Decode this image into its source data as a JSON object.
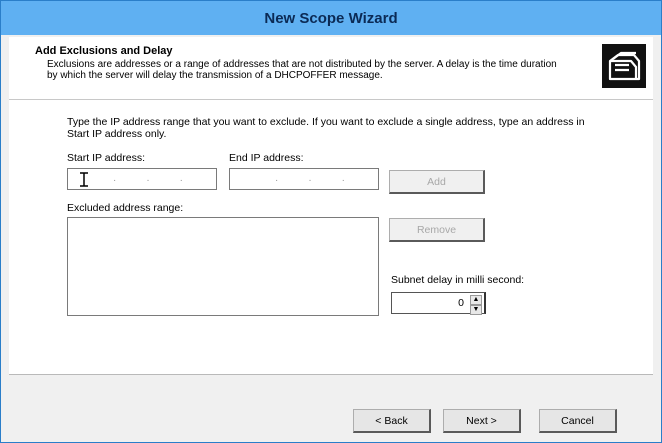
{
  "window": {
    "title": "New Scope Wizard"
  },
  "header": {
    "title": "Add Exclusions and Delay",
    "description": "Exclusions are addresses or a range of addresses that are not distributed by the server. A delay is the time duration by which the server will delay the transmission of a DHCPOFFER message.",
    "icon": "wizard-folders-icon"
  },
  "content": {
    "intro": "Type the IP address range that you want to exclude. If you want to exclude a single address, type an address in Start IP address only.",
    "start_ip_label": "Start IP address:",
    "start_ip_value": "",
    "end_ip_label": "End IP address:",
    "end_ip_value": "",
    "add_button": "Add",
    "excluded_label": "Excluded address range:",
    "excluded_items": [],
    "remove_button": "Remove",
    "delay_label": "Subnet delay in milli second:",
    "delay_value": "0"
  },
  "footer": {
    "back_button": "< Back",
    "next_button": "Next >",
    "cancel_button": "Cancel"
  },
  "colors": {
    "titlebar": "#5fb0f2",
    "window_border": "#2a7ec9"
  }
}
